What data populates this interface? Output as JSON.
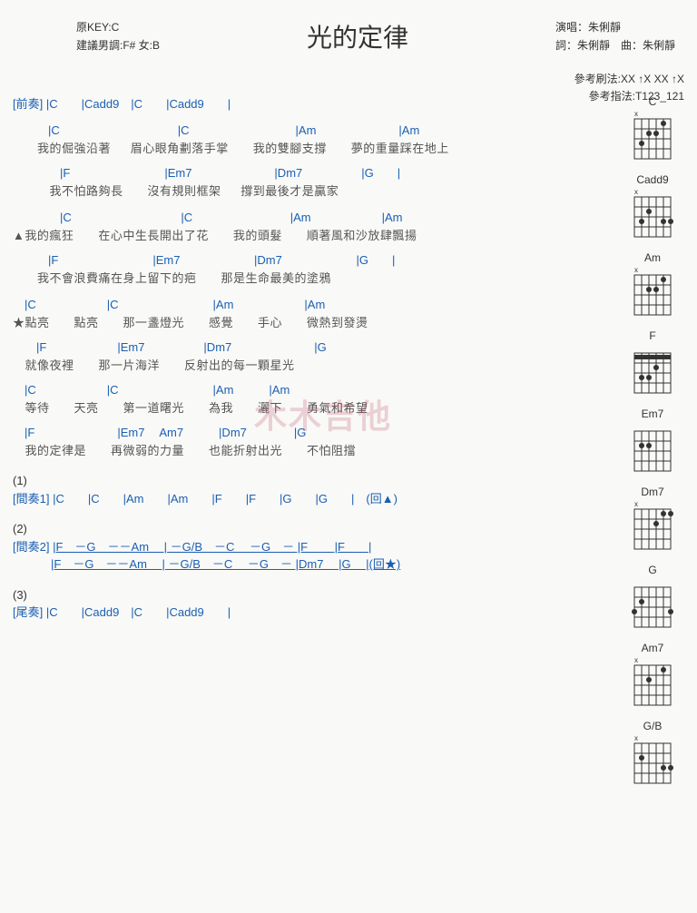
{
  "title": "光的定律",
  "meta": {
    "original_key": "原KEY:C",
    "suggest": "建議男調:F# 女:B",
    "singer": "演唱：朱俐靜",
    "credits": "詞：朱俐靜　曲：朱俐靜",
    "strum": "參考刷法:XX ↑X XX ↑X",
    "finger": "參考指法:T123_121"
  },
  "sections": {
    "intro_label": "[前奏]",
    "intro_chords": "|C　　|Cadd9　|C　　|Cadd9　　|",
    "verse1_c1": "　　　|C　　　　　　　　　　|C　　　　　　　　　|Am　　　　　　　|Am",
    "verse1_l1": "　　我的倔強沿著　  眉心眼角劃落手掌　　我的雙腳支撐　　夢的重量踩在地上",
    "verse1_c2": "　　　　|F　　　　　　　　|Em7　　　　　　　|Dm7　　　　　|G　　|",
    "verse1_l2": "　　　我不怕路夠長　　沒有規則框架　  撐到最後才是贏家",
    "verse2_c1": "　　　　|C　　　　　　　　　 |C　　　　　　　　 |Am　　　　　　|Am",
    "verse2_l1": "▲我的瘋狂　　在心中生長開出了花　　我的頭髮　　順著風和沙放肆飄揚",
    "verse2_c2": "　　　|F　　　　　　　　|Em7　　　　　　 |Dm7　　　　　　 |G　　|",
    "verse2_l2": "　　我不會浪費痛在身上留下的疤　　那是生命最美的塗鴉",
    "chorus_c1": "　|C　　　　　　|C　　　　　　　　|Am　　　　　　|Am",
    "chorus_l1": "★點亮　　點亮　　那一盞燈光　　感覺　　手心　　微熱到發燙",
    "chorus_c2": "　　|F　　　　　　|Em7　　　　　|Dm7　　　　　　　|G",
    "chorus_l2": "　就像夜裡　　那一片海洋　　反射出的每一顆星光",
    "chorus_c3": "　|C　　　　　　|C　　　　　　　　|Am　　　|Am",
    "chorus_l3": "　等待　　天亮　　第一道曙光　　為我　　灑下　　勇氣和希望",
    "chorus_c4": "　|F　　　　　　　|Em7　 Am7　　　|Dm7　　　　|G",
    "chorus_l4": "　我的定律是　　再微弱的力量　　也能折射出光　　不怕阻擋",
    "num1": "(1)",
    "inter1_label": "[間奏1]",
    "inter1_chords": "|C　　|C　　|Am　　|Am　　|F　　|F　　|G　　|G　　|　(回▲)",
    "num2": "(2)",
    "inter2_label": "[間奏2]",
    "inter2_line1": "|F　－G　－－Am　 | －G/B　－C　 －G　－  |F　　  |F　　|",
    "inter2_line2": "|F　－G　－－Am　 | －G/B　－C　 －G　－  |Dm7　  |G　 |(回★)",
    "num3": "(3)",
    "outro_label": "[尾奏]",
    "outro_chords": "|C　　|Cadd9　|C　　|Cadd9　　|"
  },
  "diagrams": [
    "C",
    "Cadd9",
    "Am",
    "F",
    "Em7",
    "Dm7",
    "G",
    "Am7",
    "G/B"
  ],
  "watermark": "木木吉他"
}
